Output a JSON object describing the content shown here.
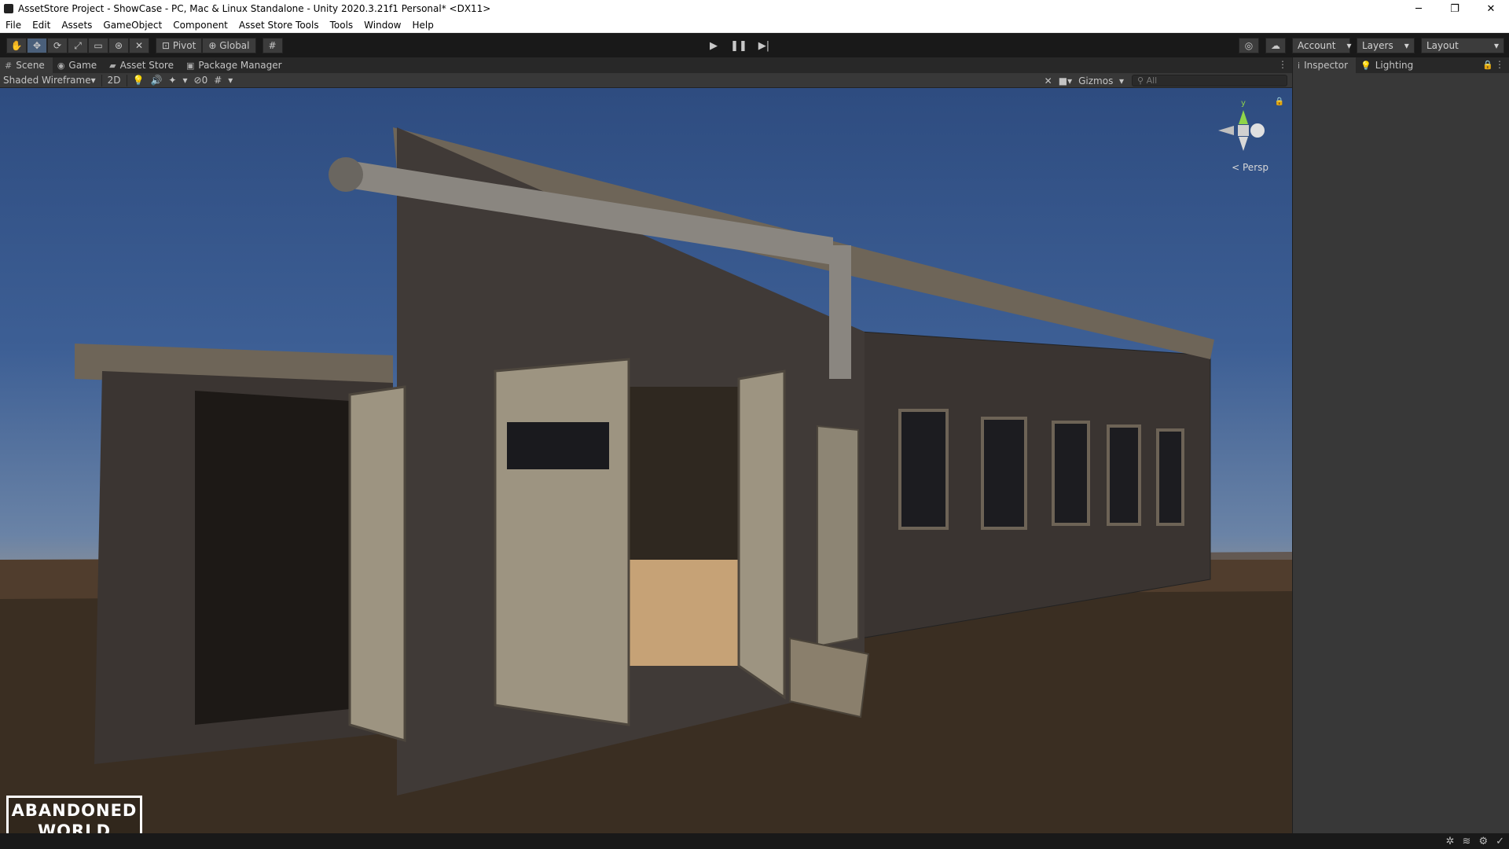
{
  "window": {
    "title": "AssetStore Project - ShowCase - PC, Mac & Linux Standalone - Unity 2020.3.21f1 Personal* <DX11>",
    "controls": [
      "─",
      "❐",
      "✕"
    ]
  },
  "menu": [
    "File",
    "Edit",
    "Assets",
    "GameObject",
    "Component",
    "Asset Store Tools",
    "Tools",
    "Window",
    "Help"
  ],
  "toolbar": {
    "tools": [
      "✋",
      "✥",
      "⟳",
      "⤢",
      "▭",
      "⊛",
      "✕"
    ],
    "pivot_label": "Pivot",
    "global_label": "Global",
    "play_controls": [
      "▶",
      "❚❚",
      "▶|"
    ],
    "account_label": "Account",
    "layers_label": "Layers",
    "layout_label": "Layout"
  },
  "tabs": [
    {
      "label": "Scene",
      "icon": "#"
    },
    {
      "label": "Game",
      "icon": "◉"
    },
    {
      "label": "Asset Store",
      "icon": "▰"
    },
    {
      "label": "Package Manager",
      "icon": "▣"
    }
  ],
  "scene_toolbar": {
    "draw_mode": "Shaded Wireframe",
    "mode_2d": "2D",
    "hidden_count": "0",
    "gizmos_label": "Gizmos",
    "search_placeholder": "All"
  },
  "viewport": {
    "gizmo_y_label": "y",
    "projection_label": "Persp",
    "logo_line1": "ABANDONED",
    "logo_line2": "WORLD"
  },
  "inspector_tabs": [
    {
      "label": "Inspector",
      "icon": "i"
    },
    {
      "label": "Lighting",
      "icon": "💡"
    }
  ],
  "colors": {
    "editor_bg": "#383838",
    "toolbar_bg": "#191919",
    "active_tool": "#4a5f7a",
    "sky_top": "#2e4c80",
    "ground": "#2c241c"
  }
}
